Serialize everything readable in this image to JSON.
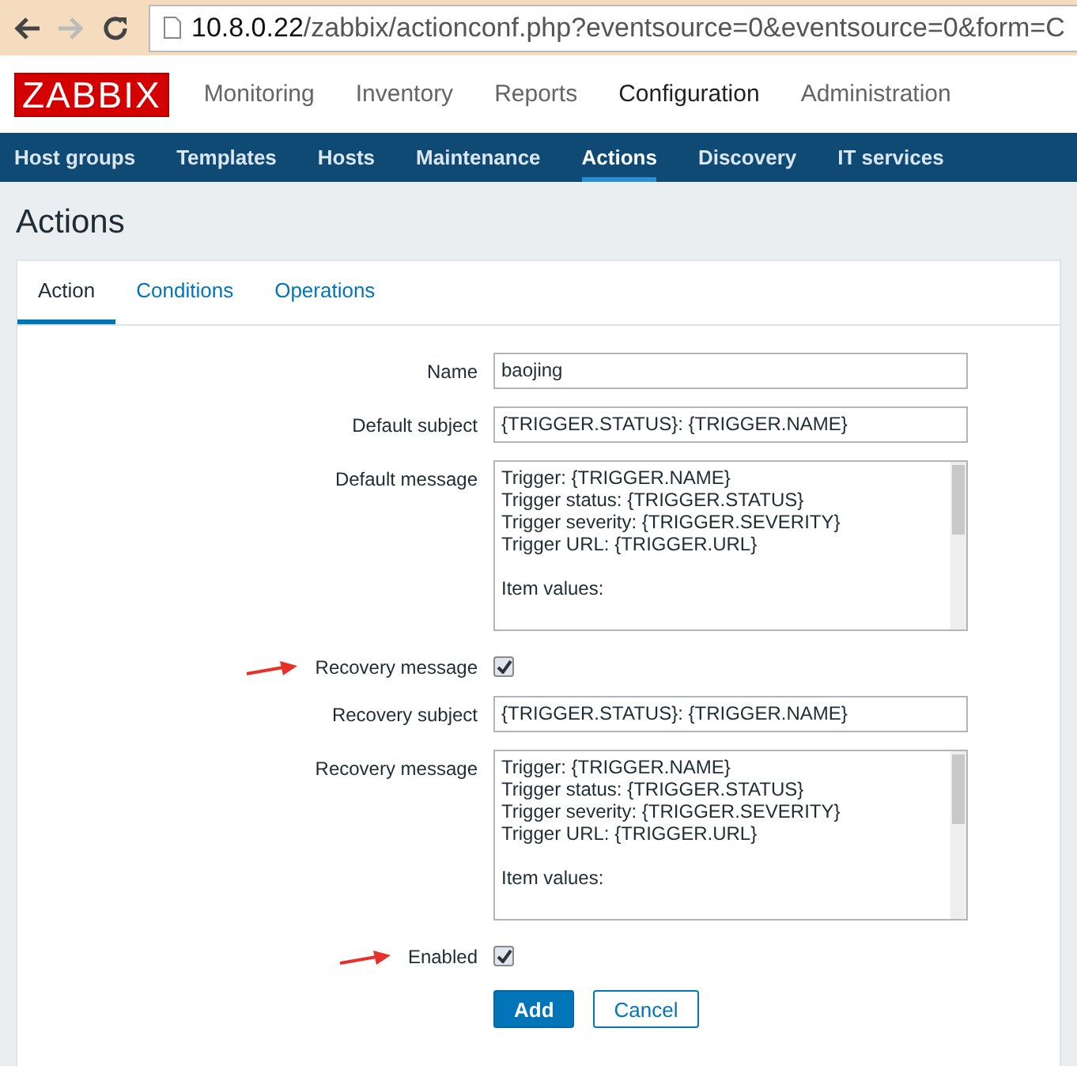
{
  "browser": {
    "url_host": "10.8.0.22",
    "url_path": "/zabbix/actionconf.php?eventsource=0&eventsource=0&form=C"
  },
  "logo": "ZABBIX",
  "main_menu": [
    {
      "label": "Monitoring",
      "selected": false
    },
    {
      "label": "Inventory",
      "selected": false
    },
    {
      "label": "Reports",
      "selected": false
    },
    {
      "label": "Configuration",
      "selected": true
    },
    {
      "label": "Administration",
      "selected": false
    }
  ],
  "sub_menu": [
    {
      "label": "Host groups",
      "selected": false
    },
    {
      "label": "Templates",
      "selected": false
    },
    {
      "label": "Hosts",
      "selected": false
    },
    {
      "label": "Maintenance",
      "selected": false
    },
    {
      "label": "Actions",
      "selected": true
    },
    {
      "label": "Discovery",
      "selected": false
    },
    {
      "label": "IT services",
      "selected": false
    }
  ],
  "page_title": "Actions",
  "tabs": [
    {
      "label": "Action",
      "selected": true
    },
    {
      "label": "Conditions",
      "selected": false
    },
    {
      "label": "Operations",
      "selected": false
    }
  ],
  "form": [
    {
      "kind": "text",
      "label": "Name",
      "value": "baojing"
    },
    {
      "kind": "text",
      "label": "Default subject",
      "value": "{TRIGGER.STATUS}: {TRIGGER.NAME}"
    },
    {
      "kind": "textarea",
      "label": "Default message",
      "value": "Trigger: {TRIGGER.NAME}\nTrigger status: {TRIGGER.STATUS}\nTrigger severity: {TRIGGER.SEVERITY}\nTrigger URL: {TRIGGER.URL}\n\nItem values:"
    },
    {
      "kind": "checkbox",
      "label": "Recovery message",
      "checked": true,
      "pointer": true
    },
    {
      "kind": "text",
      "label": "Recovery subject",
      "value": "{TRIGGER.STATUS}: {TRIGGER.NAME}"
    },
    {
      "kind": "textarea",
      "label": "Recovery message",
      "value": "Trigger: {TRIGGER.NAME}\nTrigger status: {TRIGGER.STATUS}\nTrigger severity: {TRIGGER.SEVERITY}\nTrigger URL: {TRIGGER.URL}\n\nItem values:"
    },
    {
      "kind": "checkbox",
      "label": "Enabled",
      "checked": true,
      "pointer": true
    }
  ],
  "buttons": [
    {
      "label": "Add",
      "kind": "primary"
    },
    {
      "label": "Cancel",
      "kind": "secondary"
    }
  ]
}
